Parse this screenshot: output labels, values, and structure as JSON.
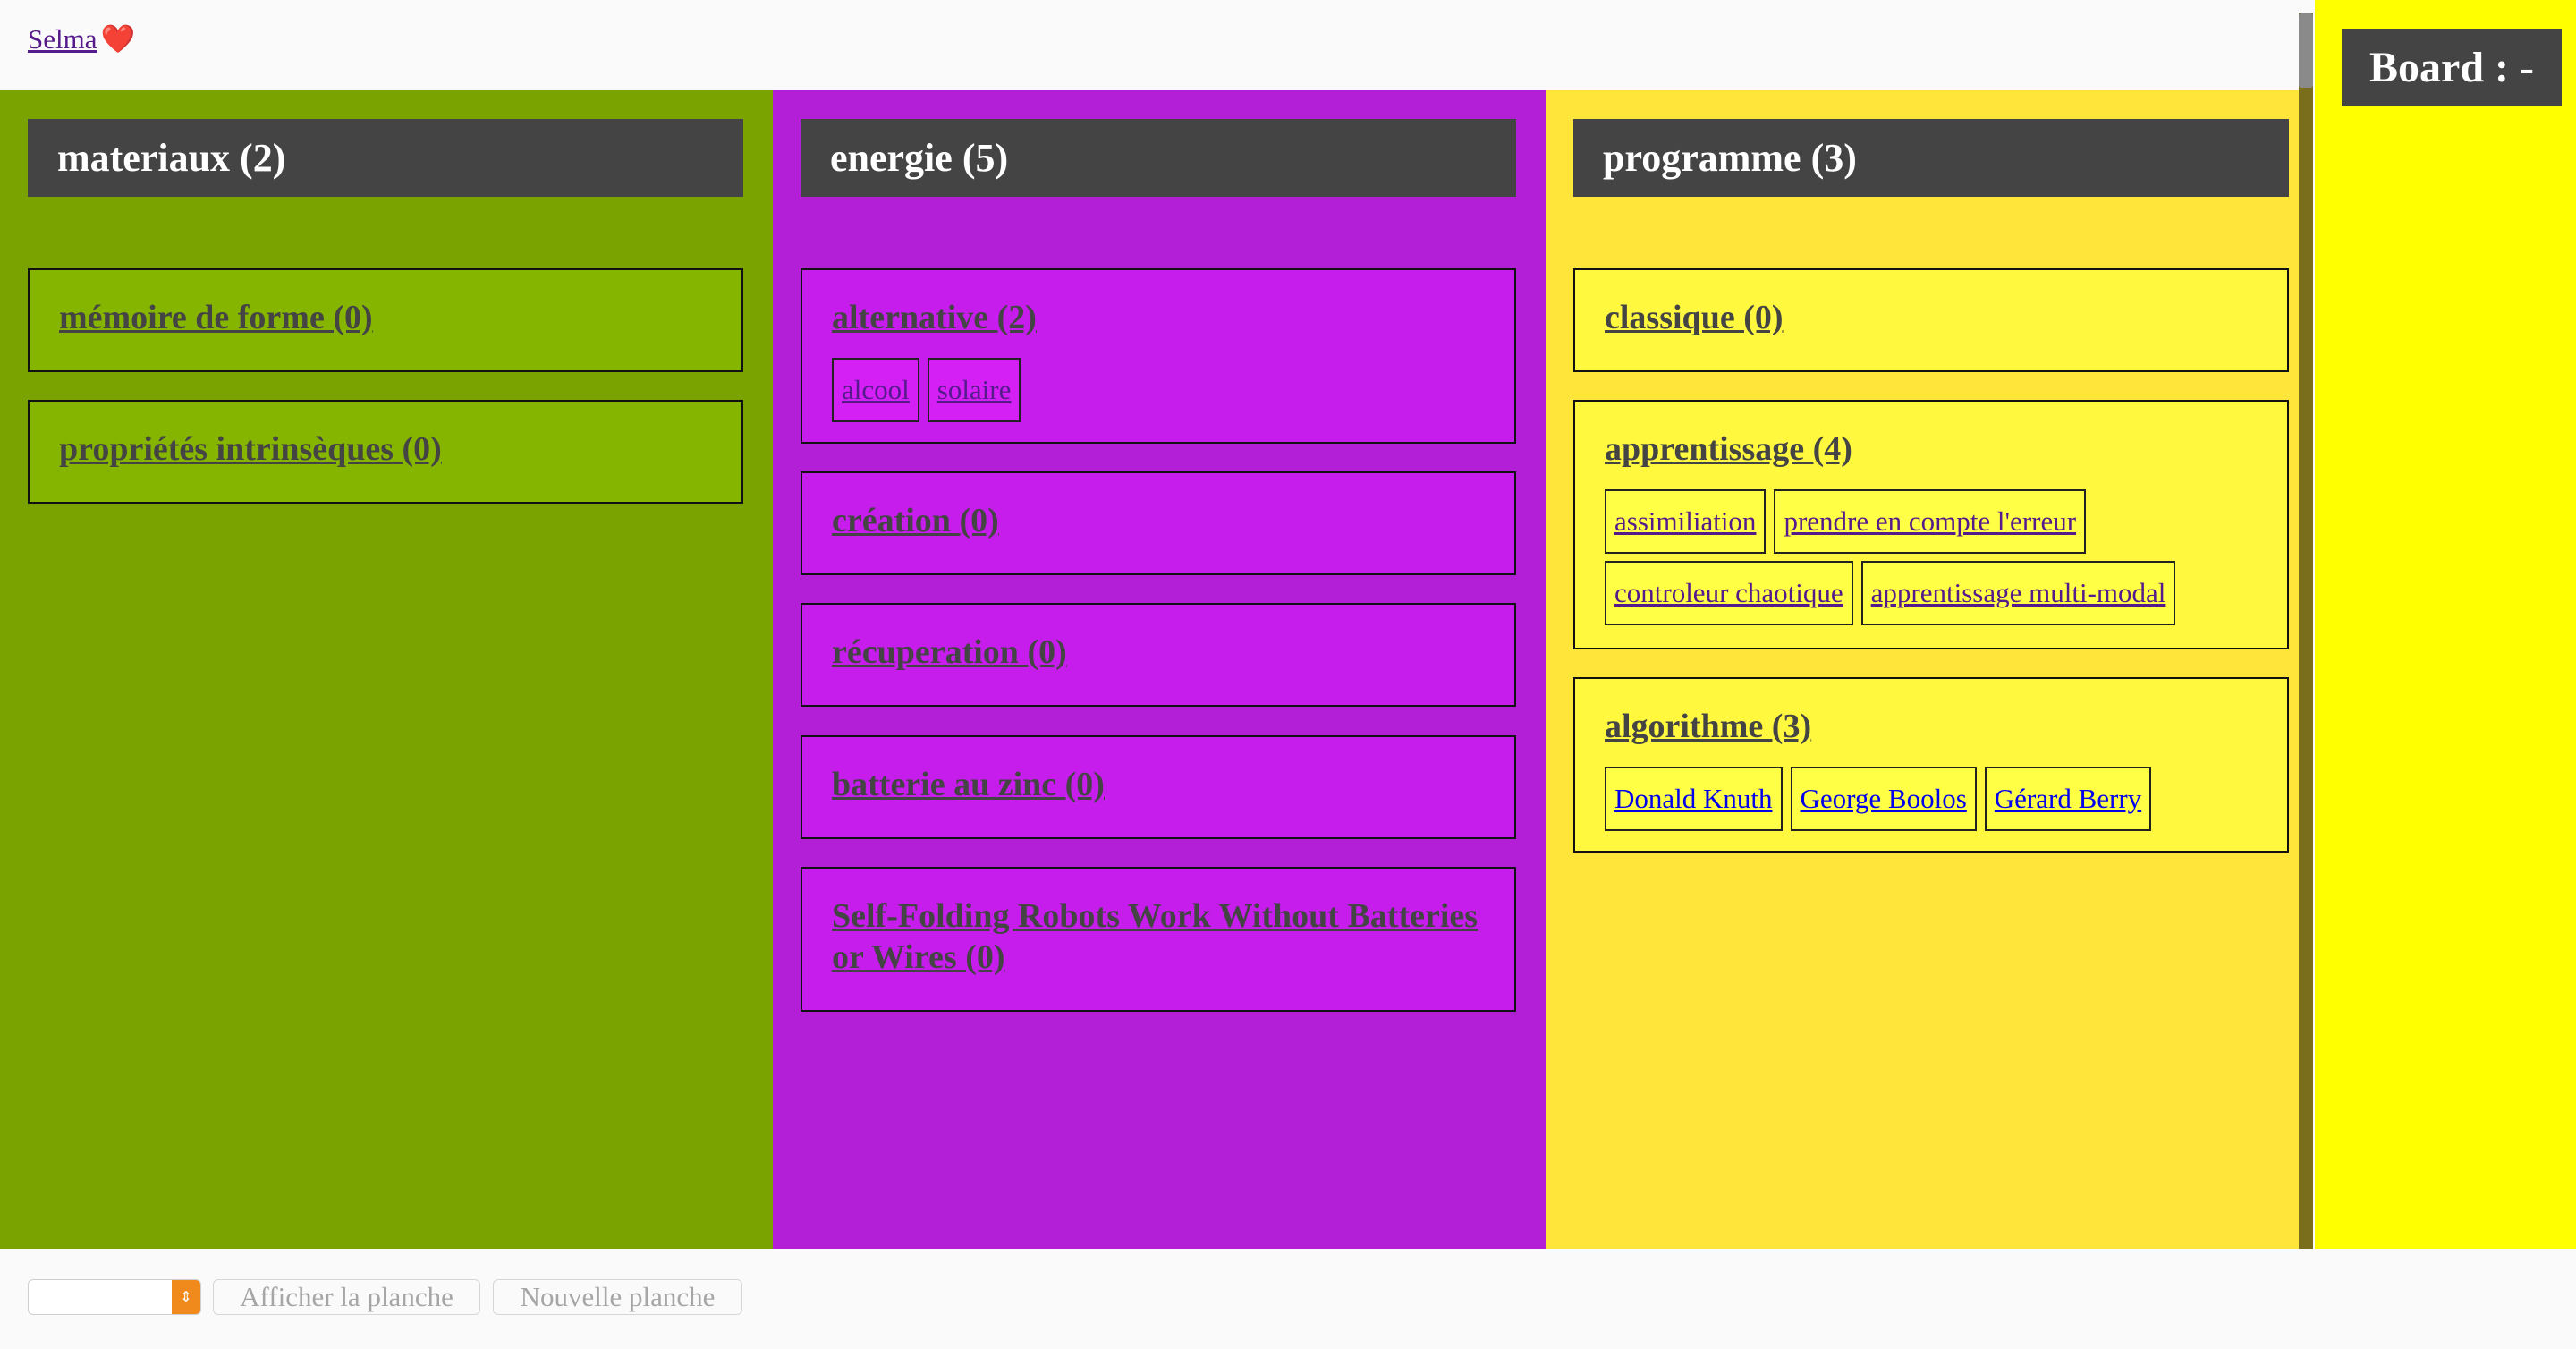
{
  "header": {
    "user_link": "Selma",
    "heart_icon": "heart-icon"
  },
  "columns": [
    {
      "title": "materiaux (2)",
      "color": "#7aa300",
      "card_color": "#86b500",
      "cards": [
        {
          "title": "mémoire de forme (0)",
          "tags": []
        },
        {
          "title": "propriétés intrinsèques (0)",
          "tags": []
        }
      ]
    },
    {
      "title": "energie (5)",
      "color": "#b21fd6",
      "card_color": "#c61cec",
      "cards": [
        {
          "title": "alternative (2)",
          "tags": [
            "alcool",
            "solaire"
          ]
        },
        {
          "title": "création (0)",
          "tags": []
        },
        {
          "title": "récuperation (0)",
          "tags": []
        },
        {
          "title": "batterie au zinc (0)",
          "tags": []
        },
        {
          "title": "Self-Folding Robots Work Without Batteries or Wires (0)",
          "tags": []
        }
      ]
    },
    {
      "title": "programme (3)",
      "color": "#ffe53a",
      "card_color": "#fff83f",
      "cards": [
        {
          "title": "classique (0)",
          "tags": []
        },
        {
          "title": "apprentissage (4)",
          "tags": [
            "assimiliation",
            "prendre en compte l'erreur",
            "controleur chaotique",
            "apprentissage multi-modal"
          ]
        },
        {
          "title": "algorithme (3)",
          "tags": [
            "Donald Knuth",
            "George Boolos",
            "Gérard Berry"
          ]
        }
      ]
    }
  ],
  "side_panel": {
    "board_label": "Board : -",
    "color": "#ffff00"
  },
  "footer": {
    "board_select_value": "",
    "show_board_button": "Afficher la planche",
    "new_board_button": "Nouvelle planche"
  }
}
